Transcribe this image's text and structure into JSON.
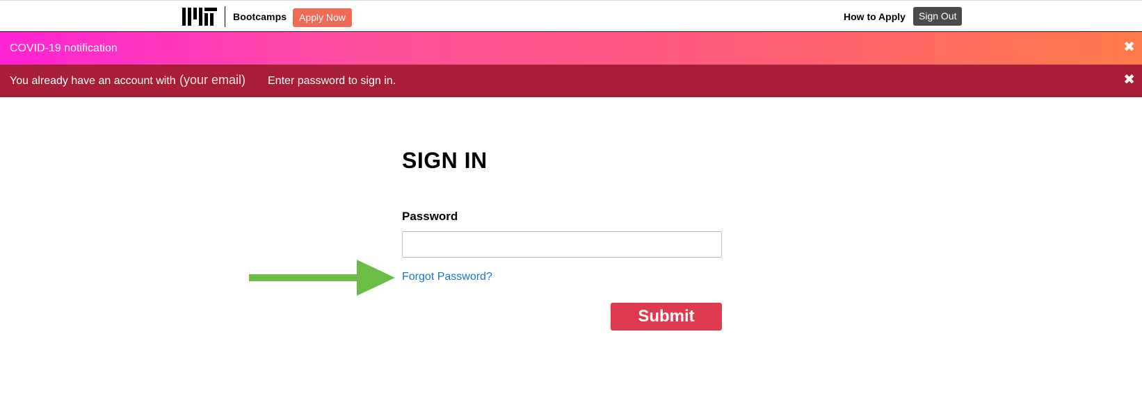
{
  "header": {
    "brand": "Bootcamps",
    "apply_label": "Apply Now",
    "how_to_apply_label": "How to Apply",
    "sign_out_label": "Sign Out"
  },
  "banners": {
    "covid": {
      "text": "COVID-19 notification",
      "close_icon": "close-icon"
    },
    "account": {
      "text_prefix": "You already have an account with",
      "email_placeholder": "(your email)",
      "text_suffix": "Enter password to sign in.",
      "close_icon": "close-icon"
    }
  },
  "form": {
    "title": "SIGN IN",
    "password_label": "Password",
    "password_value": "",
    "forgot_label": "Forgot Password?",
    "submit_label": "Submit"
  },
  "colors": {
    "apply_button": "#f06b57",
    "sign_out_button": "#4a4a4a",
    "account_banner": "#a81e36",
    "submit_button": "#e03a4f",
    "link": "#1a73d6",
    "arrow": "#6cbd45"
  },
  "icons": [
    "mit-logo",
    "close-icon",
    "arrow-right-icon"
  ]
}
